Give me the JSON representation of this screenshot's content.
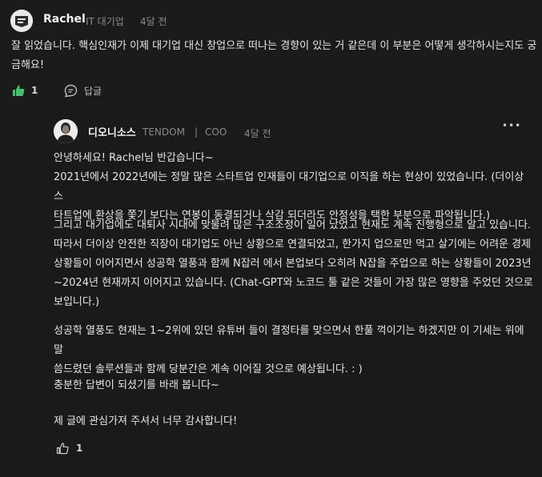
{
  "comment": {
    "author": "Rachel",
    "affiliation": "IT 대기업",
    "time": "4달 전",
    "body": "잘 읽었습니다. 핵심인재가 이제 대기업 대신 창업으로 떠나는 경향이 있는 거 같은데 이 부분은 어떻게 생각하시는지도 궁\n금해요!",
    "like_count": "1",
    "reply_label": "답글",
    "accent_color": "#3ec26a"
  },
  "reply": {
    "author": "디오니소스",
    "company": "TENDOM",
    "separator": "|",
    "role": "COO",
    "time": "4달 전",
    "more": "•••",
    "paragraphs": [
      "안녕하세요! Rachel님 반갑습니다~\n2021년에서 2022년에는 정말 많은 스타트업 인재들이 대기업으로 이직을 하는 현상이 있었습니다. (더이상 스\n타트업에 환상을 쫓기 보다는 연봉이 동결되거나 삭감 되더라도 안정성을 택한 부분으로 파악됩니다.)",
      "그리고 대기업에도 대퇴사 시대에 맞물려 많은 구조조정이 일어 났었고 현재도 계속 진행형으로 알고 있습니다.\n따라서 더이상 안전한 직장이 대기업도 아닌 상황으로 연결되었고, 한가지 업으로만 먹고 살기에는 어려운 경제\n상황들이 이어지면서 성공학 열풍과 함께 N잡러 에서 본업보다 오히려 N잡을 주업으로 하는 상황들이 2023년\n~2024년 현재까지 이어지고 있습니다. (Chat-GPT와 노코드 툴 같은 것들이 가장 많은 영향을 주었던 것으로\n보입니다.)",
      "성공학 열풍도 현재는 1~2위에 있던 유튜버 들이 결정타를 맞으면서 한풀 꺽이기는 하겠지만 이 기세는 위에 말\n씀드렸던 솔루션들과 함께 당분간은 계속 이어질 것으로 예상됩니다. : )",
      "충분한 답변이 되셨기를 바래 봅니다~",
      "제 글에 관심가져 주셔서 너무 감사합니다!"
    ],
    "like_count": "1"
  }
}
